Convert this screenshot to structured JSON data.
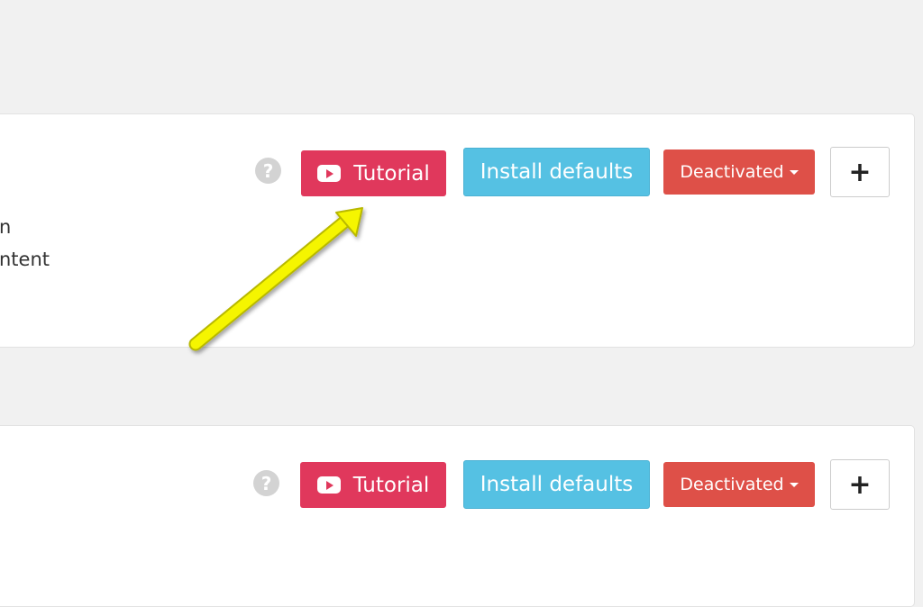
{
  "panels": [
    {
      "text_lines": [
        "n",
        "ntent"
      ],
      "help": "?",
      "tutorial": "Tutorial",
      "install": "Install defaults",
      "status": "Deactivated",
      "add": "+"
    },
    {
      "help": "?",
      "tutorial": "Tutorial",
      "install": "Install defaults",
      "status": "Deactivated",
      "add": "+"
    }
  ],
  "colors": {
    "tutorial": "#e0385c",
    "install": "#55c1e3",
    "deactivated": "#de5048",
    "arrow": "#f5f500"
  }
}
